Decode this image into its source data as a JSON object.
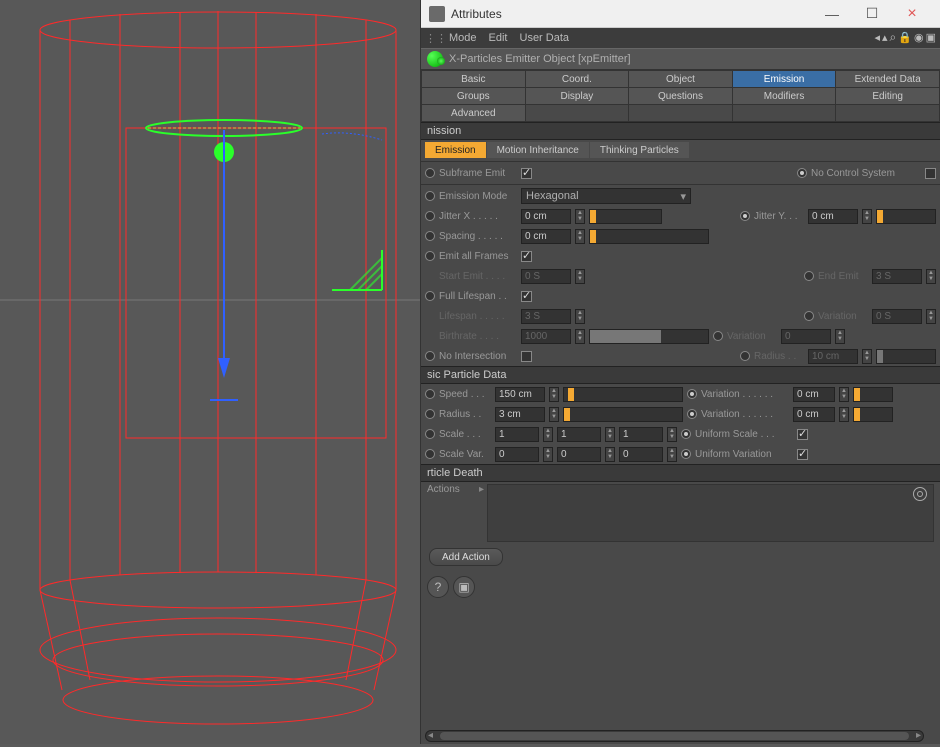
{
  "window": {
    "title": "Attributes"
  },
  "menu": {
    "mode": "Mode",
    "edit": "Edit",
    "userdata": "User Data"
  },
  "object": {
    "name": "X-Particles Emitter Object [xpEmitter]"
  },
  "tabs": {
    "row1": [
      "Basic",
      "Coord.",
      "Object",
      "Emission",
      "Extended Data"
    ],
    "row2": [
      "Groups",
      "Display",
      "Questions",
      "Modifiers",
      "Editing"
    ],
    "row3": [
      "Advanced"
    ],
    "active": "Emission"
  },
  "section": {
    "emission": "nission",
    "basic_particle": "sic Particle Data",
    "death": "rticle Death"
  },
  "subtabs": {
    "emission": "Emission",
    "motion": "Motion Inheritance",
    "thinking": "Thinking Particles"
  },
  "fields": {
    "subframe_emit": "Subframe Emit",
    "no_control": "No Control System",
    "emission_mode_lbl": "Emission Mode",
    "emission_mode_val": "Hexagonal",
    "jitter_x_lbl": "Jitter X . . . . .",
    "jitter_x_val": "0 cm",
    "jitter_y_lbl": "Jitter Y. . .",
    "jitter_y_val": "0 cm",
    "spacing_lbl": "Spacing . . . . .",
    "spacing_val": "0 cm",
    "emit_all_lbl": "Emit all Frames",
    "start_emit_lbl": "Start Emit . . . .",
    "start_emit_val": "0 S",
    "end_emit_lbl": "End Emit",
    "end_emit_val": "3 S",
    "full_lifespan_lbl": "Full Lifespan . .",
    "lifespan_lbl": "Lifespan . . . . .",
    "lifespan_val": "3 S",
    "variation_lbl": "Variation",
    "variation_val": "0 S",
    "birthrate_lbl": "Birthrate . . . .",
    "birthrate_val": "1000",
    "variation2_lbl": "Variation",
    "variation2_val": "0",
    "no_intersect_lbl": "No Intersection",
    "radius_lbl": "Radius . .",
    "radius_val": "10 cm",
    "speed_lbl": "Speed . . .",
    "speed_val": "150 cm",
    "speed_var_lbl": "Variation . . . . . .",
    "speed_var_val": "0 cm",
    "pradius_lbl": "Radius . .",
    "pradius_val": "3 cm",
    "pradius_var_lbl": "Variation . . . . . .",
    "pradius_var_val": "0 cm",
    "scale_lbl": "Scale . . .",
    "scale_x": "1",
    "scale_y": "1",
    "scale_z": "1",
    "uniform_scale_lbl": "Uniform Scale . . .",
    "scalevar_lbl": "Scale Var.",
    "scalevar_x": "0",
    "scalevar_y": "0",
    "scalevar_z": "0",
    "uniform_var_lbl": "Uniform Variation",
    "actions_lbl": "Actions",
    "add_action": "Add Action"
  }
}
